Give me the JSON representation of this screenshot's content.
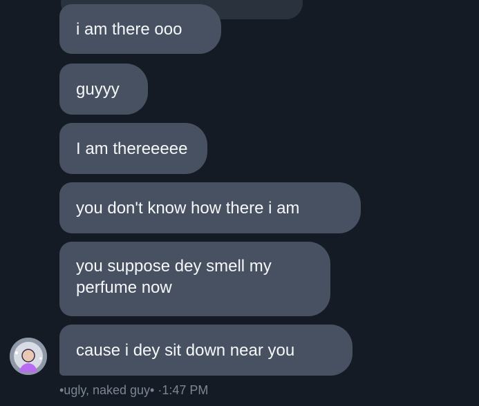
{
  "messages": [
    {
      "text": "i am there ooo"
    },
    {
      "text": "guyyy"
    },
    {
      "text": "I am thereeeee"
    },
    {
      "text": "you don't know how there i am"
    },
    {
      "text": "you suppose dey smell my perfume now"
    },
    {
      "text": "cause i dey sit down near you"
    }
  ],
  "footer": {
    "sender": "•ugly, naked guy•",
    "separator": " ·",
    "time": "1:47 PM"
  },
  "avatar": {
    "icon": "user-avatar-icon"
  },
  "colors": {
    "background": "#141b25",
    "bubble": "#475162",
    "bubble_text": "#f6f7f9",
    "meta_text": "#7c8592",
    "avatar_accent": "#b86cf0"
  }
}
